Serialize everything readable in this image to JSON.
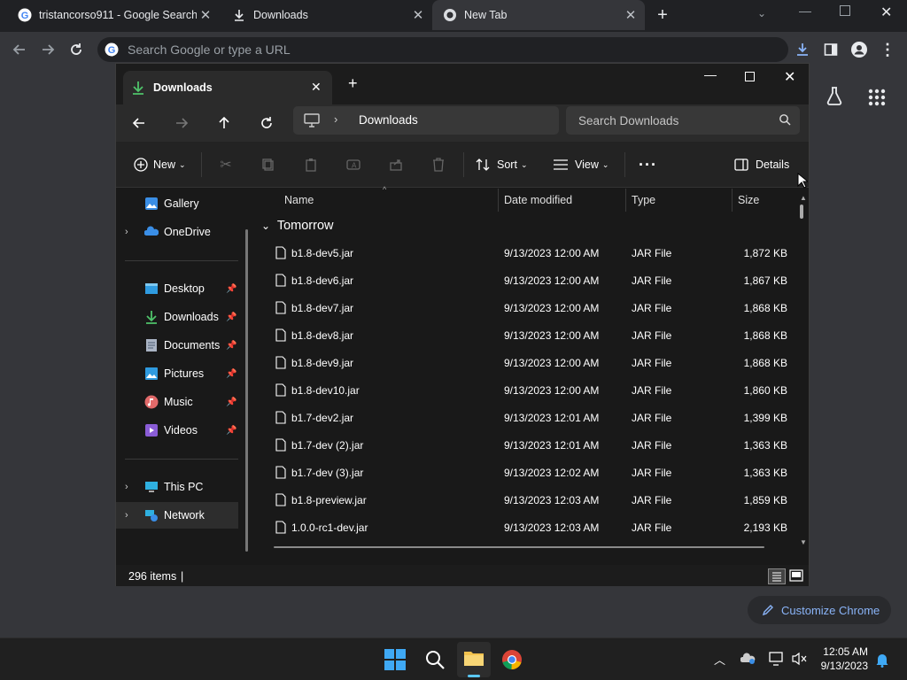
{
  "browser": {
    "tabs": [
      {
        "label": "tristancorso911 - Google Search",
        "icon": "google-icon"
      },
      {
        "label": "Downloads",
        "icon": "download-icon"
      },
      {
        "label": "New Tab",
        "icon": "chrome-icon"
      }
    ],
    "omnibox_placeholder": "Search Google or type a URL",
    "customize_label": "Customize Chrome",
    "accent": "#8ab4f8"
  },
  "explorer": {
    "tab_title": "Downloads",
    "breadcrumb": {
      "location": "Downloads"
    },
    "search_placeholder": "Search Downloads",
    "toolbar": {
      "new_label": "New",
      "sort_label": "Sort",
      "view_label": "View",
      "details_label": "Details"
    },
    "sidebar": {
      "items": [
        {
          "label": "Gallery",
          "icon": "gallery-icon"
        },
        {
          "label": "OneDrive",
          "icon": "onedrive-icon"
        },
        {
          "label": "Desktop",
          "icon": "desktop-icon"
        },
        {
          "label": "Downloads",
          "icon": "downloads-icon"
        },
        {
          "label": "Documents",
          "icon": "documents-icon"
        },
        {
          "label": "Pictures",
          "icon": "pictures-icon"
        },
        {
          "label": "Music",
          "icon": "music-icon"
        },
        {
          "label": "Videos",
          "icon": "videos-icon"
        },
        {
          "label": "This PC",
          "icon": "this-pc-icon"
        },
        {
          "label": "Network",
          "icon": "network-icon"
        }
      ]
    },
    "columns": [
      "Name",
      "Date modified",
      "Type",
      "Size"
    ],
    "group_label": "Tomorrow",
    "files": [
      {
        "name": "b1.8-dev5.jar",
        "date": "9/13/2023 12:00 AM",
        "type": "JAR File",
        "size": "1,872 KB"
      },
      {
        "name": "b1.8-dev6.jar",
        "date": "9/13/2023 12:00 AM",
        "type": "JAR File",
        "size": "1,867 KB"
      },
      {
        "name": "b1.8-dev7.jar",
        "date": "9/13/2023 12:00 AM",
        "type": "JAR File",
        "size": "1,868 KB"
      },
      {
        "name": "b1.8-dev8.jar",
        "date": "9/13/2023 12:00 AM",
        "type": "JAR File",
        "size": "1,868 KB"
      },
      {
        "name": "b1.8-dev9.jar",
        "date": "9/13/2023 12:00 AM",
        "type": "JAR File",
        "size": "1,868 KB"
      },
      {
        "name": "b1.8-dev10.jar",
        "date": "9/13/2023 12:00 AM",
        "type": "JAR File",
        "size": "1,860 KB"
      },
      {
        "name": "b1.7-dev2.jar",
        "date": "9/13/2023 12:01 AM",
        "type": "JAR File",
        "size": "1,399 KB"
      },
      {
        "name": "b1.7-dev (2).jar",
        "date": "9/13/2023 12:01 AM",
        "type": "JAR File",
        "size": "1,363 KB"
      },
      {
        "name": "b1.7-dev (3).jar",
        "date": "9/13/2023 12:02 AM",
        "type": "JAR File",
        "size": "1,363 KB"
      },
      {
        "name": "b1.8-preview.jar",
        "date": "9/13/2023 12:03 AM",
        "type": "JAR File",
        "size": "1,859 KB"
      },
      {
        "name": "1.0.0-rc1-dev.jar",
        "date": "9/13/2023 12:03 AM",
        "type": "JAR File",
        "size": "2,193 KB"
      }
    ],
    "status": {
      "item_count": "296 items"
    }
  },
  "taskbar": {
    "clock_time": "12:05 AM",
    "clock_date": "9/13/2023"
  }
}
